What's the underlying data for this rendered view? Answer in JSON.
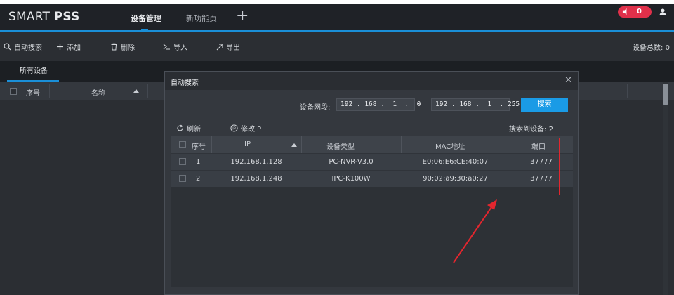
{
  "app": {
    "brand_a": "SMART",
    "brand_b": "PSS",
    "tabs": [
      "设备管理",
      "新功能页"
    ],
    "alarm_count": "0"
  },
  "toolbar": {
    "auto_search": "自动搜索",
    "add": "添加",
    "delete": "删除",
    "import": "导入",
    "export": "导出",
    "total_label": "设备总数:",
    "total_value": "0"
  },
  "device_panel": {
    "subtab": "所有设备",
    "col_index": "序号",
    "col_name": "名称"
  },
  "modal": {
    "title": "自动搜索",
    "segment_label": "设备网段:",
    "ip_start": "192 . 168 .  1  .  0",
    "ip_end": "192 . 168 .  1  . 255",
    "dash": "-",
    "search_button": "搜索",
    "refresh": "刷新",
    "modify_ip": "修改IP",
    "found_label": "搜索到设备:",
    "found_count": "2",
    "columns": [
      "序号",
      "IP",
      "设备类型",
      "MAC地址",
      "端口"
    ],
    "rows": [
      {
        "index": "1",
        "ip": "192.168.1.128",
        "type": "PC-NVR-V3.0",
        "mac": "E0:06:E6:CE:40:07",
        "port": "37777"
      },
      {
        "index": "2",
        "ip": "192.168.1.248",
        "type": "IPC-K100W",
        "mac": "90:02:a9:30:a0:27",
        "port": "37777"
      }
    ]
  },
  "colors": {
    "accent": "#1a8fd8",
    "alarm": "#e0304a",
    "annotation": "#e3262e"
  }
}
